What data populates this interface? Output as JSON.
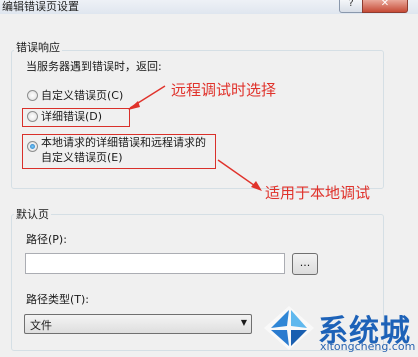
{
  "window": {
    "title": "编辑错误页设置",
    "help_glyph": "?",
    "close_glyph": "✕"
  },
  "error_response": {
    "group_title": "错误响应",
    "prompt": "当服务器遇到错误时，返回:",
    "options": [
      {
        "label": "自定义错误页(C)",
        "checked": false
      },
      {
        "label": "详细错误(D)",
        "checked": false
      },
      {
        "label_line1": "本地请求的详细错误和远程请求的",
        "label_line2": "自定义错误页(E)",
        "checked": true
      }
    ]
  },
  "annotations": {
    "remote": "远程调试时选择",
    "local": "适用于本地调试"
  },
  "default_page": {
    "group_title": "默认页",
    "path_label": "路径(P):",
    "path_value": "",
    "browse_label": "...",
    "path_type_label": "路径类型(T):",
    "path_type_value": "文件"
  },
  "watermark": {
    "brand": "系统城",
    "url": "xitongcheng.com"
  },
  "colors": {
    "annotation_red": "#e0322b",
    "logo_blue": "#1d62b8"
  }
}
